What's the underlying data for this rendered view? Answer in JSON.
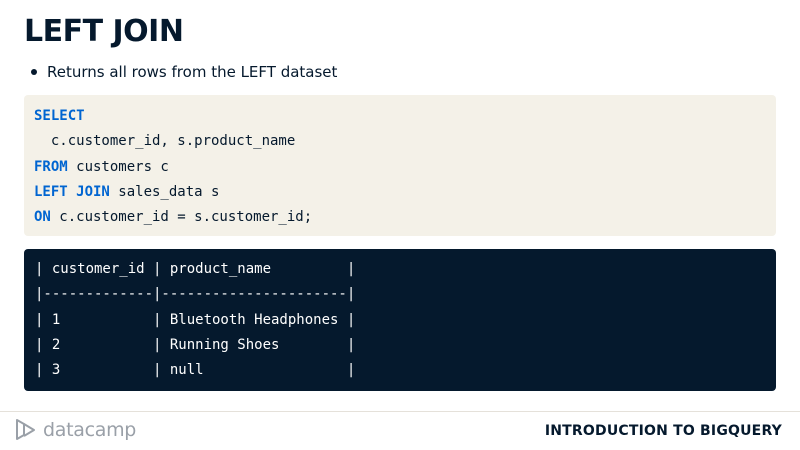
{
  "slide": {
    "title": "LEFT JOIN",
    "bullets": [
      "Returns all rows from the LEFT dataset"
    ]
  },
  "code": {
    "lines": [
      {
        "keyword": "SELECT",
        "rest": ""
      },
      {
        "keyword": "",
        "rest": "  c.customer_id, s.product_name"
      },
      {
        "keyword": "FROM",
        "rest": " customers c"
      },
      {
        "keyword": "LEFT JOIN",
        "rest": " sales_data s"
      },
      {
        "keyword": "ON",
        "rest": " c.customer_id = s.customer_id;"
      }
    ]
  },
  "output": {
    "lines": [
      "| customer_id | product_name         |",
      "|-------------|----------------------|",
      "| 1           | Bluetooth Headphones |",
      "| 2           | Running Shoes        |",
      "| 3           | null                 |"
    ]
  },
  "footer": {
    "brand": "datacamp",
    "course": "INTRODUCTION TO BIGQUERY"
  },
  "colors": {
    "navy": "#05192d",
    "keyword_blue": "#0065d1",
    "code_bg": "#f4f1e8",
    "logo_gray": "#9aa0a8"
  },
  "icons": {
    "logo": "datacamp-logo-icon"
  }
}
